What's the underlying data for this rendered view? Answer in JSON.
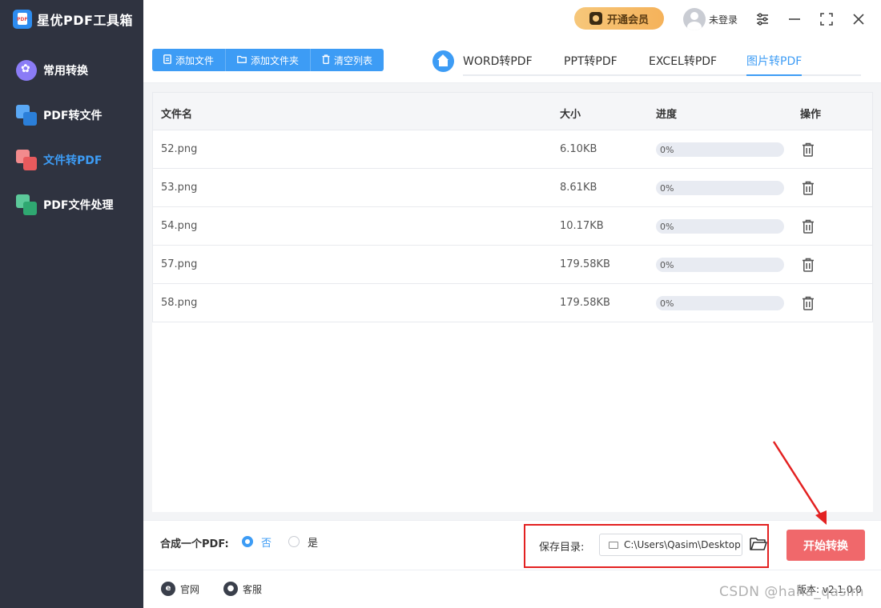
{
  "app": {
    "title": "星优PDF工具箱"
  },
  "sidebar": {
    "items": [
      {
        "label": "常用转换"
      },
      {
        "label": "PDF转文件"
      },
      {
        "label": "文件转PDF"
      },
      {
        "label": "PDF文件处理"
      }
    ],
    "active_index": 2
  },
  "header": {
    "vip_label": "开通会员",
    "user_label": "未登录",
    "settings_icon": "settings-sliders-icon",
    "minimize_icon": "minimize-icon",
    "maximize_icon": "maximize-icon",
    "close_icon": "close-icon"
  },
  "toolbar": {
    "add_file": "添加文件",
    "add_folder": "添加文件夹",
    "clear_list": "清空列表"
  },
  "tabs": [
    {
      "label": "WORD转PDF"
    },
    {
      "label": "PPT转PDF"
    },
    {
      "label": "EXCEL转PDF"
    },
    {
      "label": "图片转PDF"
    }
  ],
  "active_tab": 3,
  "table": {
    "columns": {
      "name": "文件名",
      "size": "大小",
      "progress": "进度",
      "action": "操作"
    },
    "rows": [
      {
        "name": "52.png",
        "size": "6.10KB",
        "progress_text": "0%",
        "progress": 0
      },
      {
        "name": "53.png",
        "size": "8.61KB",
        "progress_text": "0%",
        "progress": 0
      },
      {
        "name": "54.png",
        "size": "10.17KB",
        "progress_text": "0%",
        "progress": 0
      },
      {
        "name": "57.png",
        "size": "179.58KB",
        "progress_text": "0%",
        "progress": 0
      },
      {
        "name": "58.png",
        "size": "179.58KB",
        "progress_text": "0%",
        "progress": 0
      }
    ]
  },
  "bottom": {
    "merge_label": "合成一个PDF:",
    "option_no": "否",
    "option_yes": "是",
    "selected": "否",
    "save_label": "保存目录:",
    "save_path": "C:\\Users\\Qasim\\Desktop",
    "start_label": "开始转换"
  },
  "footer": {
    "website": "官网",
    "service": "客服",
    "version": "版本: v2.1.0.0"
  },
  "watermark": "CSDN @haha_qasim",
  "colors": {
    "accent": "#3d9cf5",
    "sidebar_bg": "#2f3340",
    "start_button": "#f0686b",
    "highlight_box": "#e32121"
  }
}
